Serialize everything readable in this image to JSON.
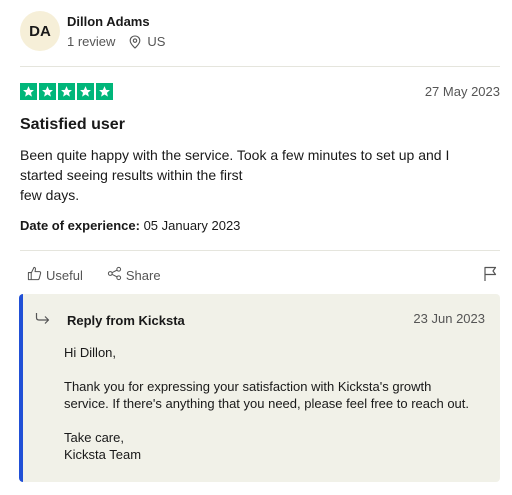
{
  "reviewer": {
    "initials": "DA",
    "name": "Dillon Adams",
    "review_count": "1 review",
    "country": "US"
  },
  "review": {
    "rating": 5,
    "date": "27 May 2023",
    "title": "Satisfied user",
    "body_lines": [
      "Been quite happy with the service. Took a few minutes to set up and I",
      "started seeing results within the first",
      "few days."
    ],
    "experience_label": "Date of experience:",
    "experience_date": "05 January 2023"
  },
  "actions": {
    "useful_label": "Useful",
    "share_label": "Share"
  },
  "reply": {
    "title": "Reply from Kicksta",
    "date": "23 Jun 2023",
    "greeting": "Hi Dillon,",
    "body_lines": [
      "Thank you for expressing your satisfaction with Kicksta's growth",
      "service. If there's anything that you need, please feel free to reach out."
    ],
    "closing": "Take care,",
    "signature": "Kicksta Team"
  },
  "colors": {
    "star_green": "#00b67a",
    "reply_accent": "#2150d6",
    "reply_bg": "#f1f1e8",
    "avatar_bg": "#f6efd8"
  }
}
